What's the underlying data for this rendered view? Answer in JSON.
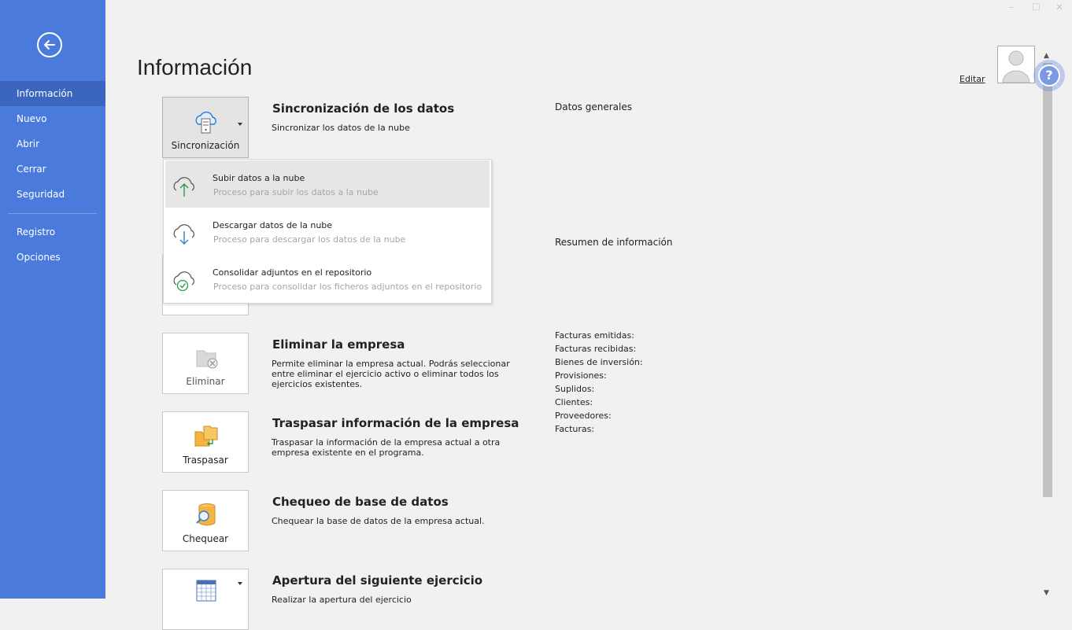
{
  "window": {
    "minimize": "–",
    "maximize": "☐",
    "close": "✕"
  },
  "nav": {
    "items": [
      {
        "label": "Información",
        "active": true
      },
      {
        "label": "Nuevo"
      },
      {
        "label": "Abrir"
      },
      {
        "label": "Cerrar"
      },
      {
        "label": "Seguridad"
      },
      {
        "label": "Registro"
      },
      {
        "label": "Opciones"
      }
    ]
  },
  "page": {
    "title": "Información"
  },
  "sections": {
    "sync": {
      "button": "Sincronización",
      "title": "Sincronización de los datos",
      "desc": "Sincronizar los datos de la nube"
    },
    "delete": {
      "button": "Eliminar",
      "title": "Eliminar la empresa",
      "desc": "Permite eliminar la empresa actual. Podrás seleccionar entre eliminar el ejercicio activo o eliminar todos los ejercicios existentes."
    },
    "transfer": {
      "button": "Traspasar",
      "title": "Traspasar información de la empresa",
      "desc": "Traspasar la información de la empresa actual a otra empresa existente en el programa."
    },
    "check": {
      "button": "Chequear",
      "title": "Chequeo de base de datos",
      "desc": "Chequear la base de datos de la empresa actual."
    },
    "opening": {
      "title": "Apertura del siguiente ejercicio",
      "desc": "Realizar la apertura del ejercicio"
    }
  },
  "dropdown": {
    "items": [
      {
        "title": "Subir datos a la nube",
        "desc": "Proceso para subir los datos a la nube",
        "icon": "cloud-upload-icon"
      },
      {
        "title": "Descargar datos de la nube",
        "desc": "Proceso para descargar los datos de la nube",
        "icon": "cloud-download-icon"
      },
      {
        "title": "Consolidar adjuntos en el repositorio",
        "desc": "Proceso para consolidar los ficheros adjuntos en el repositorio",
        "icon": "cloud-check-icon"
      }
    ]
  },
  "right": {
    "general": "Datos generales",
    "summary": "Resumen de información",
    "rows": [
      "Facturas emitidas:",
      "Facturas recibidas:",
      "Bienes de inversión:",
      "Provisiones:",
      "Suplidos:",
      "Clientes:",
      "Proveedores:",
      "Facturas:"
    ]
  },
  "profile": {
    "edit": "Editar"
  },
  "help": {
    "symbol": "?"
  },
  "colors": {
    "sidebar": "#4a7bdc",
    "sidebar_active": "#3a66c0",
    "background": "#f1f1f1"
  }
}
